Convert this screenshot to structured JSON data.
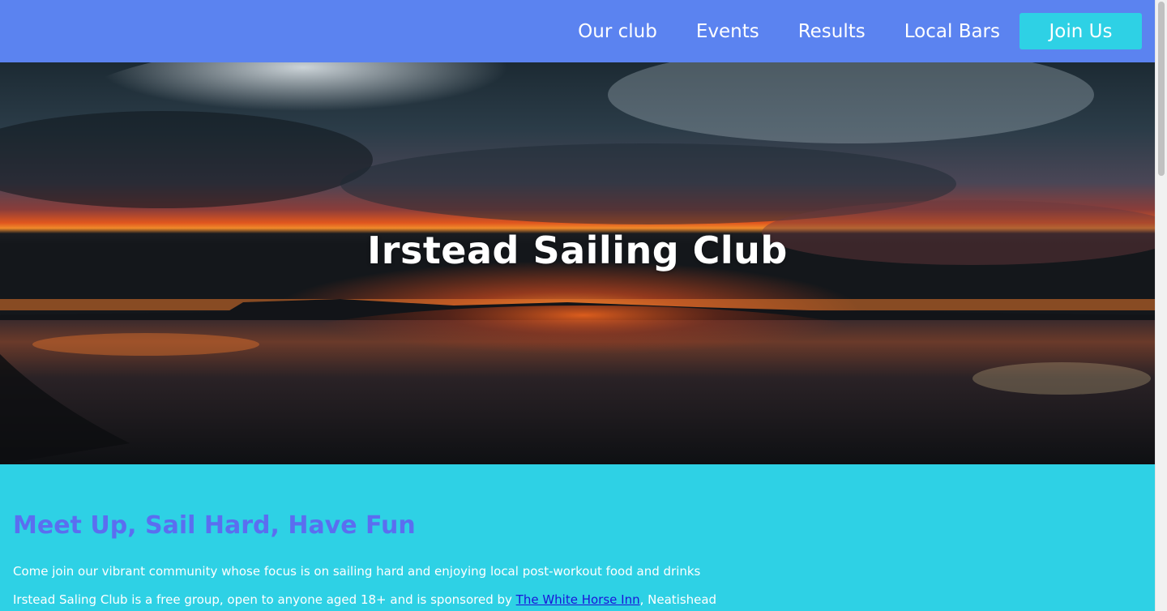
{
  "nav": {
    "items": [
      {
        "label": "Our club"
      },
      {
        "label": "Events"
      },
      {
        "label": "Results"
      },
      {
        "label": "Local Bars"
      }
    ],
    "cta_label": "Join Us"
  },
  "hero": {
    "title": "Irstead Sailing Club"
  },
  "content": {
    "heading": "Meet Up, Sail Hard, Have Fun",
    "intro": "Come join our vibrant community whose focus is on sailing hard and enjoying local post-workout food and drinks",
    "sponsor_prefix": "Irstead Saling Club is a free group, open to anyone aged 18+ and is sponsored by ",
    "sponsor_link": "The White Horse Inn",
    "sponsor_suffix": ", Neatishead"
  },
  "colors": {
    "nav_bg": "#5b83f0",
    "accent": "#2ed1e5",
    "heading": "#5b6ef0",
    "link": "#1a14d9"
  }
}
